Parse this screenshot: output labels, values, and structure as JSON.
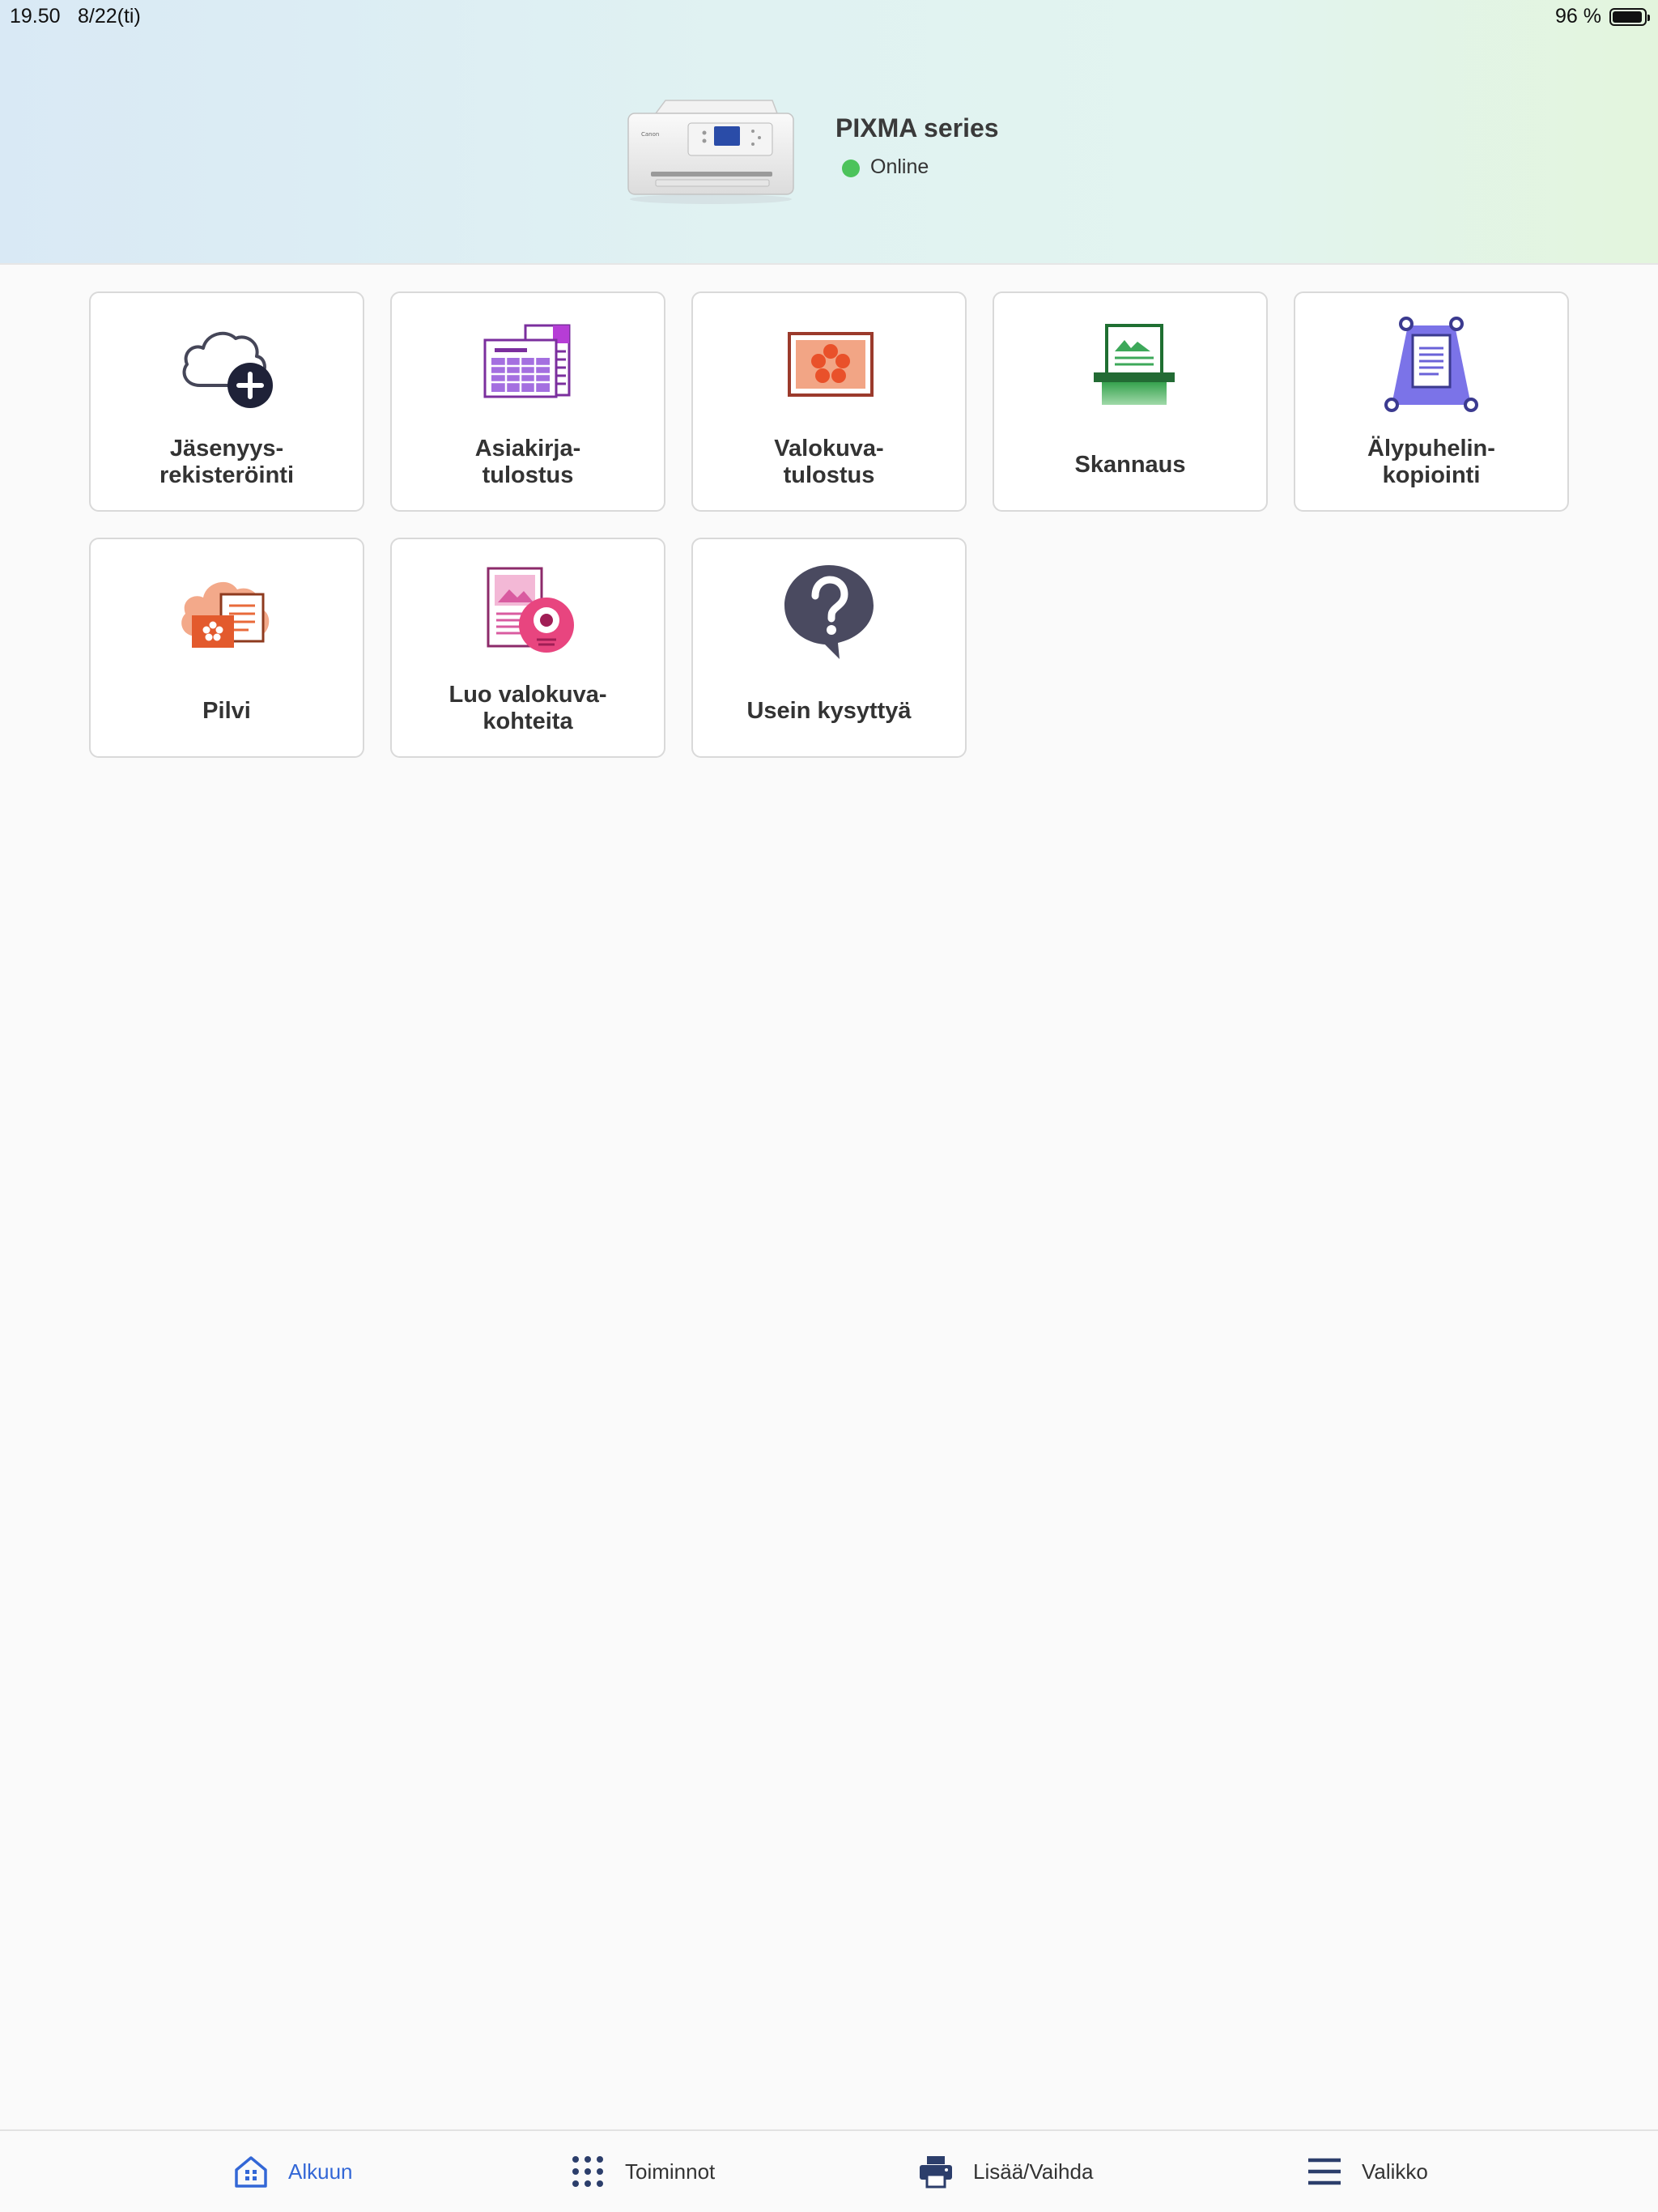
{
  "status_bar": {
    "time": "19.50",
    "date": "8/22(ti)",
    "battery_text": "96 %",
    "battery_level": 0.96
  },
  "printer": {
    "name": "PIXMA series",
    "status": "Online",
    "status_color": "#4cc35b"
  },
  "tiles": [
    {
      "label": "Jäsenyys-\nrekisteröinti",
      "icon": "cloud-plus-icon"
    },
    {
      "label": "Asiakirja-\ntulostus",
      "icon": "document-print-icon"
    },
    {
      "label": "Valokuva-\ntulostus",
      "icon": "photo-print-icon"
    },
    {
      "label": "Skannaus",
      "icon": "scanner-icon"
    },
    {
      "label": "Älypuhelin-\nkopiointi",
      "icon": "smartphone-copy-icon"
    },
    {
      "label": "Pilvi",
      "icon": "cloud-icon"
    },
    {
      "label": "Luo valokuva-\nkohteita",
      "icon": "create-photo-items-icon"
    },
    {
      "label": "Usein kysyttyä",
      "icon": "faq-question-icon"
    }
  ],
  "bottom_nav": [
    {
      "label": "Alkuun",
      "icon": "home-icon",
      "active": true
    },
    {
      "label": "Toiminnot",
      "icon": "grid-dots-icon",
      "active": false
    },
    {
      "label": "Lisää/Vaihda",
      "icon": "printer-icon",
      "active": false
    },
    {
      "label": "Valikko",
      "icon": "hamburger-menu-icon",
      "active": false
    }
  ],
  "colors": {
    "accent": "#3367d6",
    "nav_dark": "#2c3e6b"
  }
}
